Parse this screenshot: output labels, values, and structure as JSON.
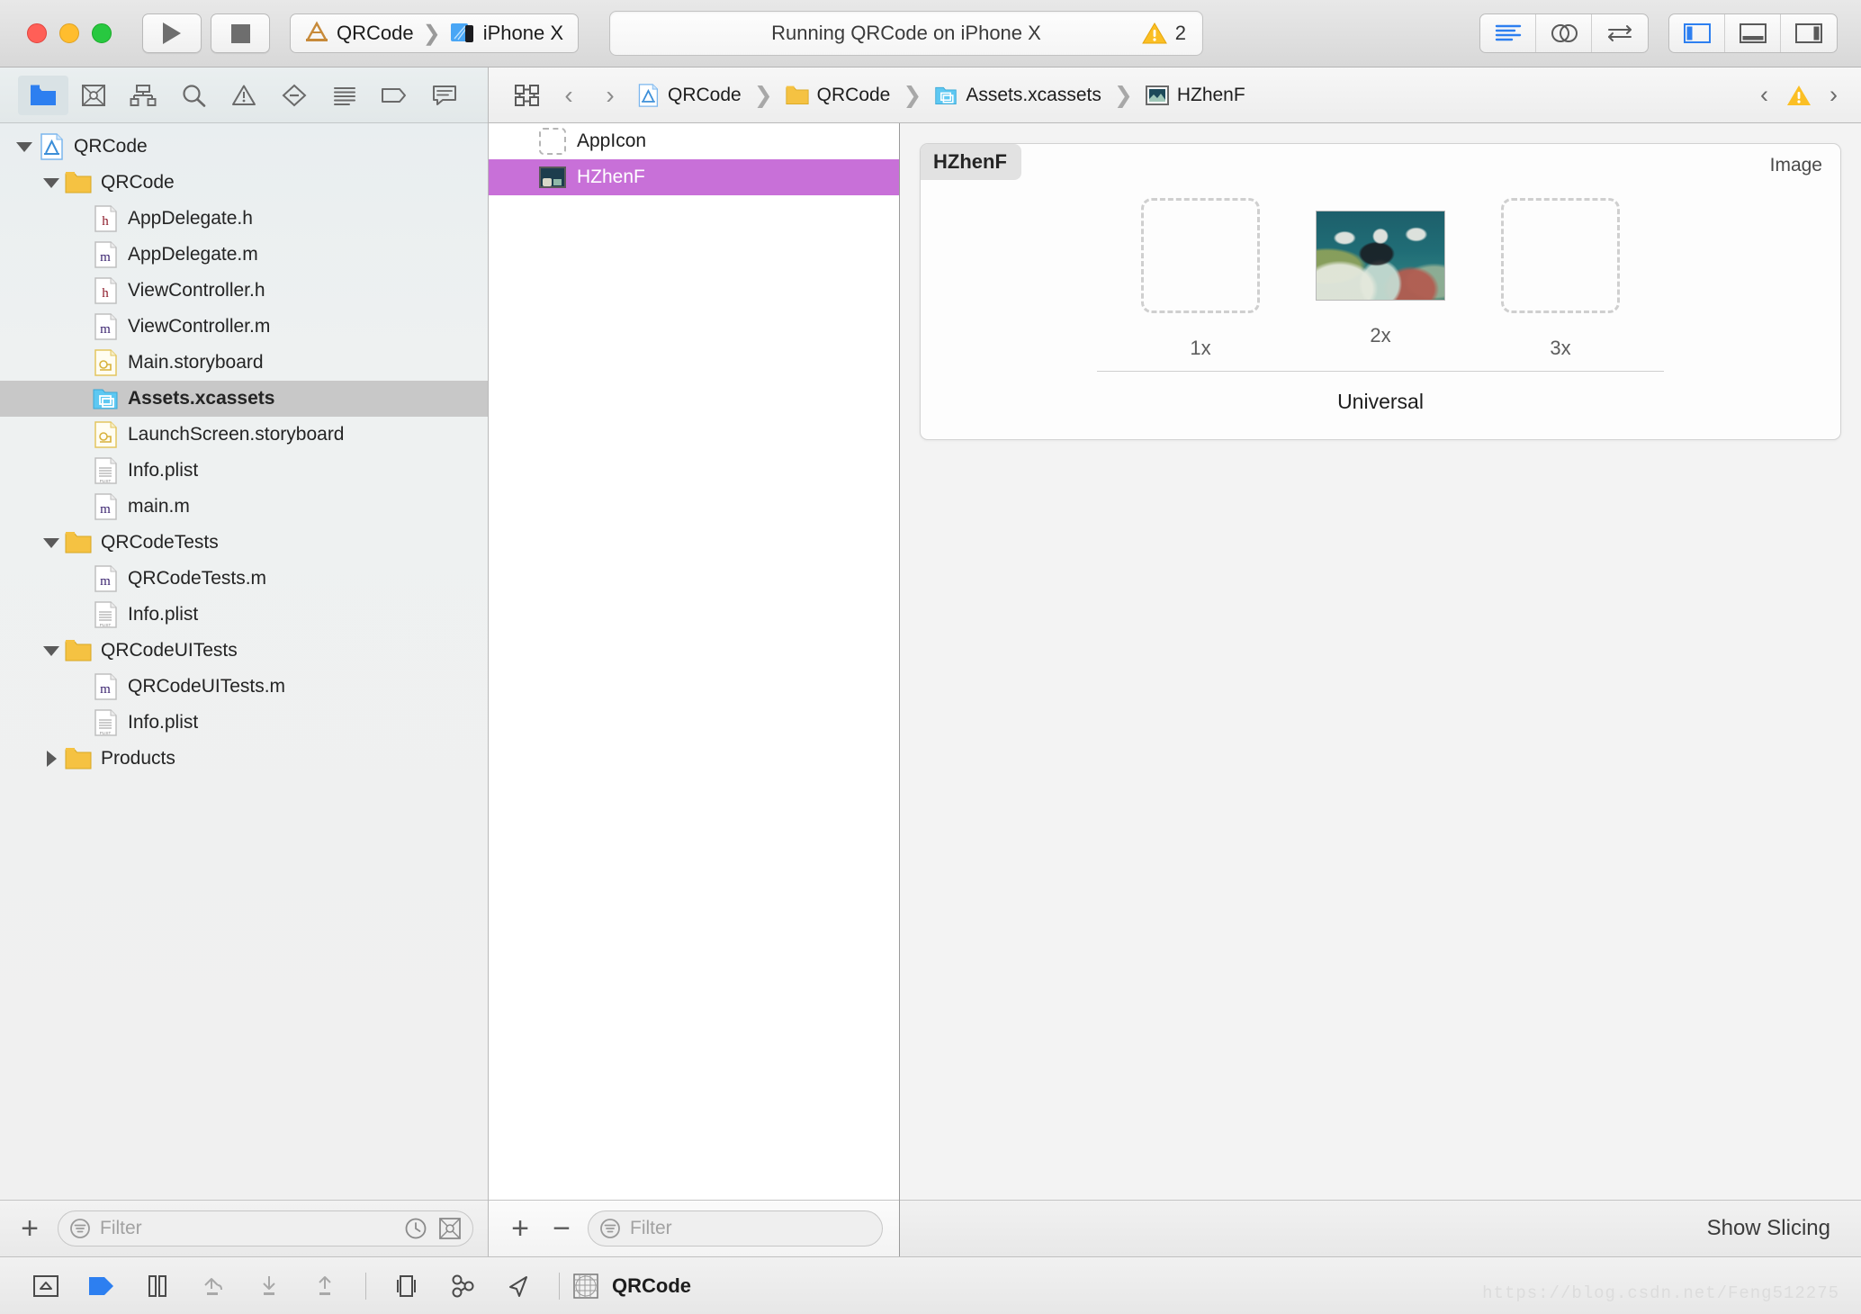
{
  "window": {
    "traffic_lights": [
      "close",
      "minimize",
      "zoom"
    ],
    "run_button": "run-icon",
    "stop_button": "stop-icon",
    "scheme": {
      "project": "QRCode",
      "destination": "iPhone X"
    },
    "status": {
      "text": "Running QRCode on iPhone X",
      "warning_count": "2"
    },
    "right_controls": {
      "editor_group": [
        "standard-editor-icon",
        "assistant-editor-icon",
        "version-editor-icon"
      ],
      "view_group": [
        "navigator-toggle-icon",
        "debug-area-toggle-icon",
        "utilities-toggle-icon"
      ]
    }
  },
  "navigator": {
    "toolbar_icons": [
      "project-navigator-icon",
      "source-control-navigator-icon",
      "symbol-navigator-icon",
      "find-navigator-icon",
      "issue-navigator-icon",
      "test-navigator-icon",
      "debug-navigator-icon",
      "breakpoint-navigator-icon",
      "report-navigator-icon"
    ],
    "tree": [
      {
        "label": "QRCode",
        "indent": 0,
        "twisty": "down",
        "icon": "xcode-project-icon",
        "selected": false
      },
      {
        "label": "QRCode",
        "indent": 1,
        "twisty": "down",
        "icon": "folder-icon",
        "selected": false
      },
      {
        "label": "AppDelegate.h",
        "indent": 2,
        "twisty": "none",
        "icon": "header-file-icon",
        "selected": false
      },
      {
        "label": "AppDelegate.m",
        "indent": 2,
        "twisty": "none",
        "icon": "objc-file-icon",
        "selected": false
      },
      {
        "label": "ViewController.h",
        "indent": 2,
        "twisty": "none",
        "icon": "header-file-icon",
        "selected": false
      },
      {
        "label": "ViewController.m",
        "indent": 2,
        "twisty": "none",
        "icon": "objc-file-icon",
        "selected": false
      },
      {
        "label": "Main.storyboard",
        "indent": 2,
        "twisty": "none",
        "icon": "storyboard-icon",
        "selected": false
      },
      {
        "label": "Assets.xcassets",
        "indent": 2,
        "twisty": "none",
        "icon": "assets-icon",
        "selected": true
      },
      {
        "label": "LaunchScreen.storyboard",
        "indent": 2,
        "twisty": "none",
        "icon": "storyboard-icon",
        "selected": false
      },
      {
        "label": "Info.plist",
        "indent": 2,
        "twisty": "none",
        "icon": "plist-icon",
        "selected": false
      },
      {
        "label": "main.m",
        "indent": 2,
        "twisty": "none",
        "icon": "objc-file-icon",
        "selected": false
      },
      {
        "label": "QRCodeTests",
        "indent": 1,
        "twisty": "down",
        "icon": "folder-icon",
        "selected": false
      },
      {
        "label": "QRCodeTests.m",
        "indent": 2,
        "twisty": "none",
        "icon": "objc-file-icon",
        "selected": false
      },
      {
        "label": "Info.plist",
        "indent": 2,
        "twisty": "none",
        "icon": "plist-icon",
        "selected": false
      },
      {
        "label": "QRCodeUITests",
        "indent": 1,
        "twisty": "down",
        "icon": "folder-icon",
        "selected": false
      },
      {
        "label": "QRCodeUITests.m",
        "indent": 2,
        "twisty": "none",
        "icon": "objc-file-icon",
        "selected": false
      },
      {
        "label": "Info.plist",
        "indent": 2,
        "twisty": "none",
        "icon": "plist-icon",
        "selected": false
      },
      {
        "label": "Products",
        "indent": 1,
        "twisty": "right",
        "icon": "folder-icon",
        "selected": false
      }
    ],
    "footer": {
      "add_label": "+",
      "filter_placeholder": "Filter",
      "recent_icon": "clock-icon",
      "scm_icon": "source-control-icon"
    }
  },
  "jumpbar": {
    "related_icon": "related-items-icon",
    "back_label": "‹",
    "forward_label": "›",
    "crumbs": [
      {
        "label": "QRCode",
        "icon": "xcode-project-icon"
      },
      {
        "label": "QRCode",
        "icon": "folder-icon"
      },
      {
        "label": "Assets.xcassets",
        "icon": "assets-icon"
      },
      {
        "label": "HZhenF",
        "icon": "imageset-icon"
      }
    ],
    "issue_prev": "‹",
    "issue_icon": "warning-icon",
    "issue_next": "›"
  },
  "asset_pane": {
    "items": [
      {
        "label": "AppIcon",
        "icon": "appicon-placeholder-icon",
        "selected": false
      },
      {
        "label": "HZhenF",
        "icon": "imageset-thumbnail-icon",
        "selected": true
      }
    ],
    "footer": {
      "add_label": "+",
      "remove_label": "−",
      "filter_placeholder": "Filter"
    }
  },
  "imageset_editor": {
    "name": "HZhenF",
    "kind": "Image",
    "slots": [
      {
        "scale": "1x",
        "filled": false
      },
      {
        "scale": "2x",
        "filled": true
      },
      {
        "scale": "3x",
        "filled": false
      }
    ],
    "device_label": "Universal",
    "show_slicing_label": "Show Slicing"
  },
  "debug_bar": {
    "icons": [
      "hide-debug-area-icon",
      "continue-icon",
      "pause-icon",
      "step-over-icon",
      "step-into-icon",
      "step-out-icon",
      "view-hierarchy-icon",
      "memory-graph-icon",
      "location-simulate-icon"
    ],
    "process_icon": "process-icon",
    "process_name": "QRCode"
  },
  "watermark": "https://blog.csdn.net/Feng512275",
  "colors": {
    "selection_purple": "#c870d8",
    "accent_blue": "#2d7ff0",
    "warning_yellow": "#fbbf24",
    "nav_selection_gray": "#c8c8c8"
  }
}
